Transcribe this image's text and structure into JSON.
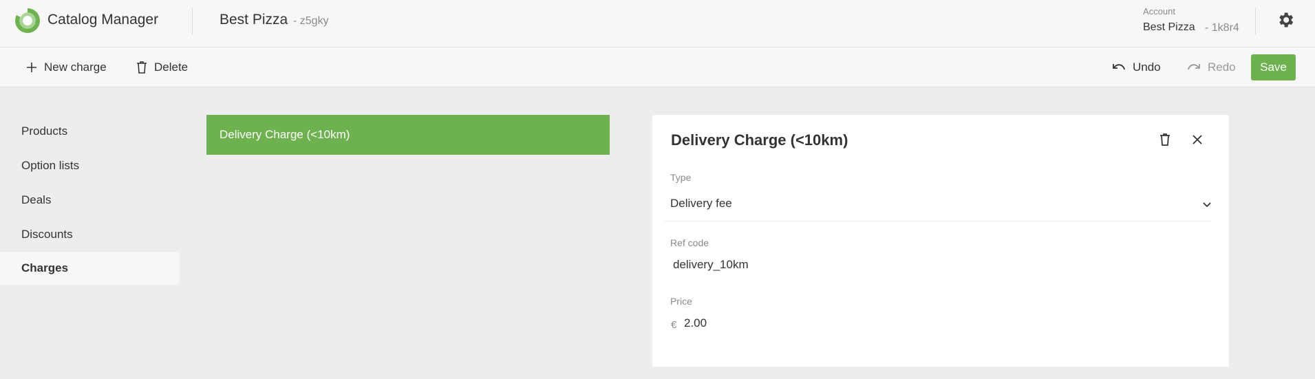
{
  "app": {
    "title": "Catalog Manager",
    "store_name": "Best Pizza",
    "store_id": "-  z5gky",
    "brand_color": "#6db24f",
    "logo_icon": "catalog-logo"
  },
  "account": {
    "label": "Account",
    "name": "Best Pizza",
    "id": "- 1k8r4",
    "settings_icon": "gear-icon"
  },
  "toolbar": {
    "new_label": "New charge",
    "delete_label": "Delete",
    "undo_label": "Undo",
    "redo_label": "Redo",
    "save_label": "Save"
  },
  "sidebar": {
    "items": [
      {
        "label": "Products",
        "active": false
      },
      {
        "label": "Option lists",
        "active": false
      },
      {
        "label": "Deals",
        "active": false
      },
      {
        "label": "Discounts",
        "active": false
      },
      {
        "label": "Charges",
        "active": true
      }
    ]
  },
  "list": {
    "items": [
      {
        "label": "Delivery Charge (<10km)",
        "selected": true
      }
    ]
  },
  "detail": {
    "title": "Delivery Charge (<10km)",
    "type_label": "Type",
    "type_value": "Delivery fee",
    "ref_label": "Ref code",
    "ref_value": "delivery_10km",
    "price_label": "Price",
    "currency": "€",
    "price_value": "2.00"
  }
}
